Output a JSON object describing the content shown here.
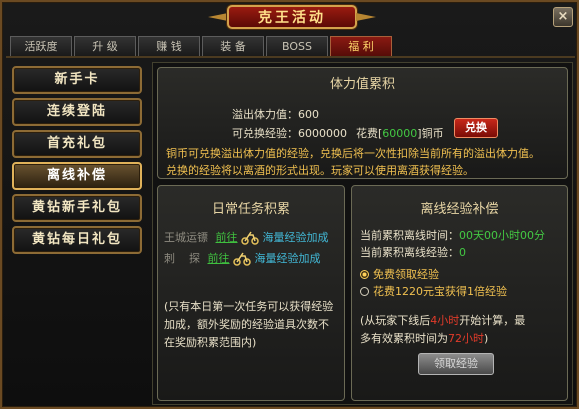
{
  "window": {
    "title": "克王活动",
    "close_label": "×"
  },
  "tabs": [
    {
      "label": "活跃度"
    },
    {
      "label": "升 级"
    },
    {
      "label": "赚 钱"
    },
    {
      "label": "装 备"
    },
    {
      "label": "BOSS"
    },
    {
      "label": "福 利"
    }
  ],
  "menu": [
    {
      "label": "新手卡"
    },
    {
      "label": "连续登陆"
    },
    {
      "label": "首充礼包"
    },
    {
      "label": "离线补偿"
    },
    {
      "label": "黄钻新手礼包"
    },
    {
      "label": "黄钻每日礼包"
    }
  ],
  "stamina": {
    "title": "体力值累积",
    "overflow_label": "溢出体力值：",
    "overflow_value": "600",
    "exchangeable_label": "可兑换经验：",
    "exchangeable_value": "6000000",
    "cost_prefix": "花费[",
    "cost_value": "60000",
    "cost_suffix": "]铜币",
    "exchange_button": "兑换",
    "note_line1": "铜币可兑换溢出体力值的经验，兑换后将一次性扣除当前所有的溢出体力值。",
    "note_line2": "兑换的经验将以离酒的形式出现。玩家可以使用离酒获得经验。"
  },
  "daily": {
    "title": "日常任务积累",
    "rows": [
      {
        "task": "王城运镖",
        "go": "前往",
        "reward": "海量经验加成"
      },
      {
        "task": "刺    探",
        "go": "前往",
        "reward": "海量经验加成"
      }
    ],
    "note_line1": "(只有本日第一次任务可以获得经验",
    "note_line2": "加成，额外奖励的经验道具次数不",
    "note_line3": "在奖励积累范围内)"
  },
  "offline": {
    "title": "离线经验补偿",
    "time_label": "当前累积离线时间：",
    "time_value": "00天00小时00分",
    "exp_label": "当前累积离线经验：",
    "exp_value": "0",
    "option_free": "免费领取经验",
    "option_paid": "花费1220元宝获得1倍经验",
    "note_a": "(从玩家下线后",
    "note_hours": "4小时",
    "note_b": "开始计算，最",
    "note_c": "多有效累积时间为",
    "note_max": "72小时",
    "note_d": ")",
    "claim_button": "领取经验"
  }
}
